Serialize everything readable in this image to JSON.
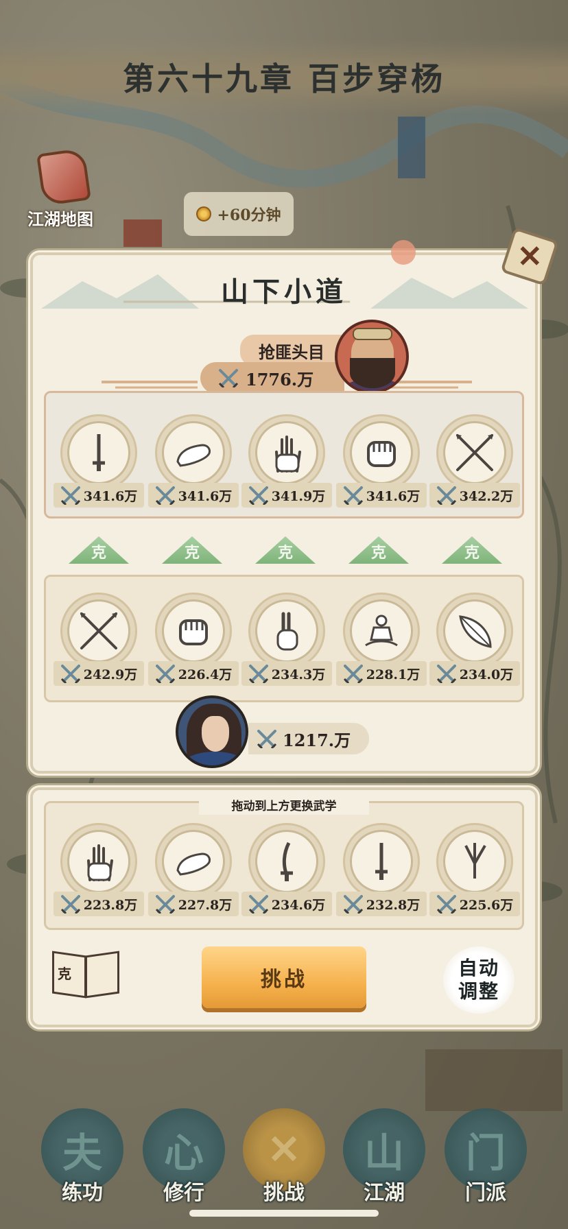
{
  "chapter": {
    "title": "第六十九章 百步穿杨"
  },
  "map_button": {
    "label": "江湖地图",
    "icon": "map-scroll-icon"
  },
  "timer": {
    "text": "+60分钟"
  },
  "stage": {
    "title": "山下小道"
  },
  "enemy": {
    "name": "抢匪头目",
    "power": "1776.万",
    "skills": [
      {
        "icon": "sword-icon",
        "power": "341.6万"
      },
      {
        "icon": "shoe-icon",
        "power": "341.6万"
      },
      {
        "icon": "palm-icon",
        "power": "341.9万"
      },
      {
        "icon": "fist-icon",
        "power": "341.6万"
      },
      {
        "icon": "crossed-spears-icon",
        "power": "342.2万"
      }
    ]
  },
  "counter_label": "克",
  "player": {
    "power": "1217.万",
    "skills": [
      {
        "icon": "crossed-spears-icon",
        "power": "242.9万"
      },
      {
        "icon": "fist-icon",
        "power": "226.4万"
      },
      {
        "icon": "two-finger-icon",
        "power": "234.3万"
      },
      {
        "icon": "meditation-icon",
        "power": "228.1万"
      },
      {
        "icon": "feather-icon",
        "power": "234.0万"
      }
    ]
  },
  "inventory": {
    "hint": "拖动到上方更换武学",
    "skills": [
      {
        "icon": "palm-icon",
        "power": "223.8万"
      },
      {
        "icon": "shoe-icon",
        "power": "227.8万"
      },
      {
        "icon": "saber-icon",
        "power": "234.6万"
      },
      {
        "icon": "sword-icon",
        "power": "232.8万"
      },
      {
        "icon": "throwing-darts-icon",
        "power": "225.6万"
      }
    ]
  },
  "actions": {
    "challenge": "挑战",
    "auto_line1": "自动",
    "auto_line2": "调整",
    "book_char": "克"
  },
  "nav": [
    {
      "label": "练功",
      "glyph": "夫"
    },
    {
      "label": "修行",
      "glyph": "心"
    },
    {
      "label": "挑战",
      "glyph": "✕"
    },
    {
      "label": "江湖",
      "glyph": "山"
    },
    {
      "label": "门派",
      "glyph": "门"
    }
  ],
  "colors": {
    "accent": "#f6b24e",
    "counter": "#8fbf8a",
    "panel": "#f4efe0"
  }
}
